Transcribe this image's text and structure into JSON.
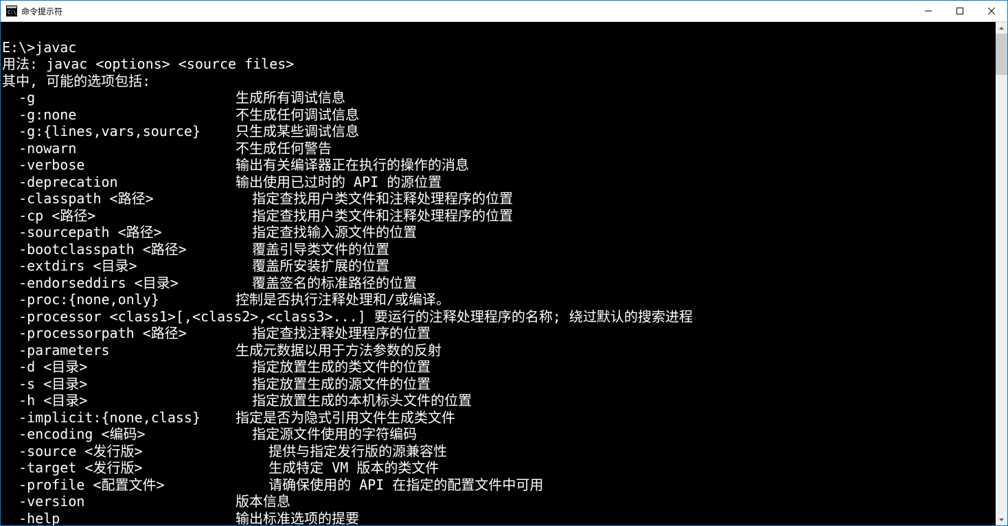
{
  "window": {
    "title": "命令提示符"
  },
  "terminal": {
    "prompt": "E:\\>",
    "command": "javac",
    "usage": "用法: javac <options> <source files>",
    "header": "其中, 可能的选项包括:",
    "processor_line": "  -processor <class1>[,<class2>,<class3>...] 要运行的注释处理程序的名称; 绕过默认的搜索进程",
    "options": [
      {
        "flag": "  -g",
        "desc": "生成所有调试信息"
      },
      {
        "flag": "  -g:none",
        "desc": "不生成任何调试信息"
      },
      {
        "flag": "  -g:{lines,vars,source}",
        "desc": "只生成某些调试信息"
      },
      {
        "flag": "  -nowarn",
        "desc": "不生成任何警告"
      },
      {
        "flag": "  -verbose",
        "desc": "输出有关编译器正在执行的操作的消息"
      },
      {
        "flag": "  -deprecation",
        "desc": "输出使用已过时的 API 的源位置"
      },
      {
        "flag": "  -classpath <路径>",
        "desc": "  指定查找用户类文件和注释处理程序的位置"
      },
      {
        "flag": "  -cp <路径>",
        "desc": "  指定查找用户类文件和注释处理程序的位置"
      },
      {
        "flag": "  -sourcepath <路径>",
        "desc": "  指定查找输入源文件的位置"
      },
      {
        "flag": "  -bootclasspath <路径>",
        "desc": "  覆盖引导类文件的位置"
      },
      {
        "flag": "  -extdirs <目录>",
        "desc": "  覆盖所安装扩展的位置"
      },
      {
        "flag": "  -endorseddirs <目录>",
        "desc": "  覆盖签名的标准路径的位置"
      },
      {
        "flag": "  -proc:{none,only}",
        "desc": "控制是否执行注释处理和/或编译。"
      }
    ],
    "options2": [
      {
        "flag": "  -processorpath <路径>",
        "desc": "  指定查找注释处理程序的位置"
      },
      {
        "flag": "  -parameters",
        "desc": "生成元数据以用于方法参数的反射"
      },
      {
        "flag": "  -d <目录>",
        "desc": "  指定放置生成的类文件的位置"
      },
      {
        "flag": "  -s <目录>",
        "desc": "  指定放置生成的源文件的位置"
      },
      {
        "flag": "  -h <目录>",
        "desc": "  指定放置生成的本机标头文件的位置"
      },
      {
        "flag": "  -implicit:{none,class}",
        "desc": "指定是否为隐式引用文件生成类文件"
      },
      {
        "flag": "  -encoding <编码>",
        "desc": "  指定源文件使用的字符编码"
      },
      {
        "flag": "  -source <发行版>",
        "desc": "    提供与指定发行版的源兼容性"
      },
      {
        "flag": "  -target <发行版>",
        "desc": "    生成特定 VM 版本的类文件"
      },
      {
        "flag": "  -profile <配置文件>",
        "desc": "    请确保使用的 API 在指定的配置文件中可用"
      },
      {
        "flag": "  -version",
        "desc": "版本信息"
      },
      {
        "flag": "  -help",
        "desc": "输出标准选项的提要"
      }
    ]
  }
}
